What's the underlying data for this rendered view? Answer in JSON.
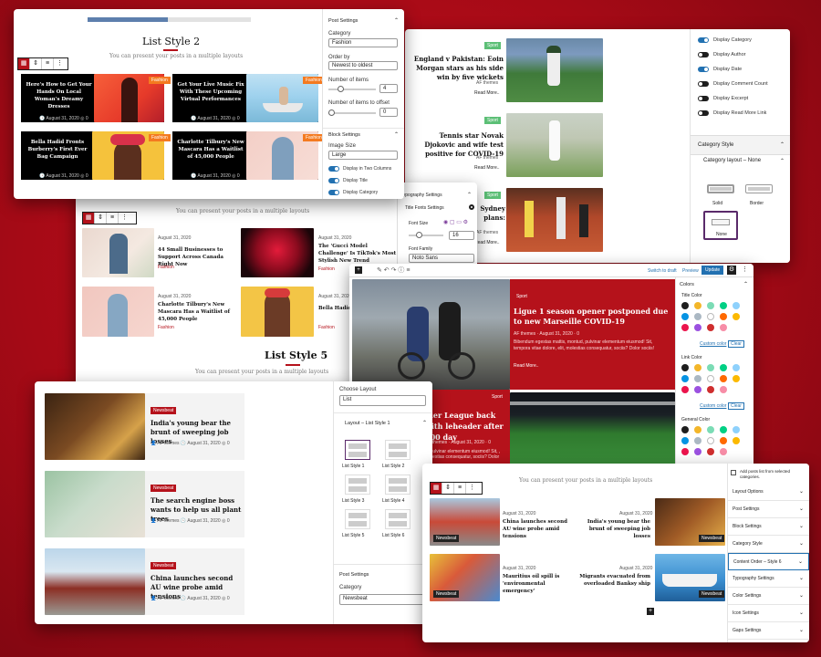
{
  "win_a": {
    "title": "List Style 2",
    "subtitle": "You can present your posts in a multiple layouts",
    "cards": [
      {
        "title": "Here's How to Get Your Hands On Local Woman's Dreamy Dresses",
        "date": "August 31, 2020",
        "count": "0",
        "tag": "Fashion"
      },
      {
        "title": "Get Your Live Music Fix With These Upcoming Virtual Performances",
        "date": "August 31, 2020",
        "count": "0",
        "tag": "Fashion"
      },
      {
        "title": "Bella Hadid Fronts Burberry's First Ever Bag Campaign",
        "date": "August 31, 2020",
        "count": "0",
        "tag": "Fashion"
      },
      {
        "title": "Charlotte Tilbury's New Mascara Has a Waitlist of 45,000 People",
        "date": "August 31, 2020",
        "count": "0",
        "tag": "Fashion"
      }
    ],
    "panel": {
      "section": "Post Settings",
      "category_label": "Category",
      "category_value": "Fashion",
      "order_label": "Order by",
      "order_value": "Newest to oldest",
      "num_label": "Number of items",
      "num_value": "4",
      "offset_label": "Number of items to offset",
      "offset_value": "0",
      "block_settings": "Block Settings",
      "image_size_label": "Image Size",
      "image_size_value": "Large",
      "toggles": [
        "Display in Two Columns",
        "Display Title",
        "Display Category"
      ]
    }
  },
  "win_b": {
    "posts": [
      {
        "tag": "Sport",
        "title": "England v Pakistan: Eoin Morgan stars as his side win by five wickets",
        "author": "AF themes",
        "more": "Read More.."
      },
      {
        "tag": "Sport",
        "title": "Tennis star Novak Djokovic and wife test positive for COVID-19",
        "author": "AF themes",
        "more": "Read More.."
      },
      {
        "tag": "Sport",
        "title": "Sydney plans: Global 'the clock'",
        "author": "AF themes",
        "more": "Read More.."
      }
    ],
    "toggles": [
      {
        "label": "Display Category",
        "on": true
      },
      {
        "label": "Display Author",
        "on": false
      },
      {
        "label": "Display Date",
        "on": true
      },
      {
        "label": "Display Comment Count",
        "on": false
      },
      {
        "label": "Display Excerpt",
        "on": false
      },
      {
        "label": "Display Read More Link",
        "on": false
      }
    ],
    "category_style": "Category Style",
    "category_layout": "Category layout – None",
    "opts": [
      "Solid",
      "Border",
      "None"
    ]
  },
  "win_c": {
    "subtitle": "You can present your posts in a multiple layouts",
    "list_title": "List Style 5",
    "list_sub": "You can present your posts in a multiple layouts",
    "posts": [
      {
        "date": "August 31, 2020",
        "title": "44 Small Businesses to Support Across Canada Right Now",
        "tag": "Fashion"
      },
      {
        "date": "August 31, 2020",
        "title": "The 'Gucci Model Challenge' Is TikTok's Most Stylish New Trend",
        "tag": "Fashion"
      },
      {
        "date": "August 31, 2020",
        "title": "Charlotte Tilbury's New Mascara Has a Waitlist of 45,000 People",
        "tag": "Fashion"
      },
      {
        "date": "August 31, 2020",
        "title": "Bella Hadid",
        "tag": "Fashion"
      }
    ],
    "typo": {
      "title": "Typography Settings",
      "font": "Title Fonts Settings",
      "size_label": "Font Size",
      "size_value": "16",
      "family_label": "Font Family",
      "family_value": "Noto Sans"
    }
  },
  "win_d": {
    "topbar": {
      "switch": "Switch to draft",
      "preview": "Preview",
      "update": "Update"
    },
    "posts": [
      {
        "tag": "Sport",
        "title": "Ligue 1 season opener postponed due to new Marseille COVID-19",
        "author": "AF themes",
        "date": "August 31, 2020",
        "count": "0",
        "excerpt": "Bibendum egestas mattis, montud, pulvinar elementum eiusmod! Sit, tempora vitae dolore, elit, molestias consequatur, sociis? Dolor sociis!",
        "more": "Read More.."
      },
      {
        "tag": "Sport",
        "title": "nier League back with leheader after 100 day",
        "author": "AF themes",
        "date": "August 31, 2020",
        "count": "0",
        "excerpt": "o, pulvinar elementum eiusmod! Sit, , molestias consequatur, sociis? Dolor"
      }
    ],
    "panel": {
      "colors": "Colors",
      "title_color": "Title Color",
      "link_color": "Link Color",
      "general_color": "General Color",
      "custom": "Custom color",
      "clear": "Clear"
    },
    "swatches": [
      "#1e1e1e",
      "#f3b62a",
      "#7bdcb5",
      "#00d084",
      "#8ed1fc",
      "#0693e3",
      "#abb8c3",
      "#ffffff",
      "#ff6900",
      "#fcb900",
      "#eb144c",
      "#9b51e0",
      "#cf2e2e",
      "#f78da7"
    ]
  },
  "win_e": {
    "posts": [
      {
        "tag": "Newsbeat",
        "title": "India's young bear the brunt of sweeping job losses",
        "author": "AF themes",
        "date": "August 31, 2020",
        "count": "0"
      },
      {
        "tag": "Newsbeat",
        "title": "The search engine boss wants to help us all plant trees",
        "author": "AF themes",
        "date": "August 31, 2020",
        "count": "0"
      },
      {
        "tag": "Newsbeat",
        "title": "China launches second AU wine probe amid tensions",
        "author": "AF themes",
        "date": "August 31, 2020",
        "count": "0"
      }
    ],
    "panel": {
      "choose": "Choose Layout",
      "choose_value": "List",
      "layout": "Layout – List Style 1",
      "styles": [
        "List Style 1",
        "List Style 2",
        "List Style 3",
        "List Style 4",
        "List Style 5",
        "List Style 6"
      ],
      "post_settings": "Post Settings",
      "category": "Category",
      "category_value": "Newsbeat"
    }
  },
  "win_f": {
    "subtitle": "You can present your posts in a multiple layouts",
    "posts": [
      {
        "date": "August 31, 2020",
        "title": "China launches second AU wine probe amid tensions",
        "tag": "Newsbeat"
      },
      {
        "date": "August 31, 2020",
        "title": "India's young bear the brunt of sweeping job losses",
        "tag": "Newsbeat"
      },
      {
        "date": "August 31, 2020",
        "title": "Mauritius oil spill is 'environmental emergency'",
        "tag": "Newsbeat"
      },
      {
        "date": "August 31, 2020",
        "title": "Migrants evacuated from overloaded Banksy ship",
        "tag": "Newsbeat"
      }
    ],
    "panel": {
      "top": "Add posts list from selected categories.",
      "rows": [
        "Layout Options",
        "Post Settings",
        "Block Settings",
        "Category Style",
        "Content Order – Style 6",
        "Typography Settings",
        "Color Settings",
        "Icon Settings",
        "Gaps Settings"
      ]
    }
  }
}
